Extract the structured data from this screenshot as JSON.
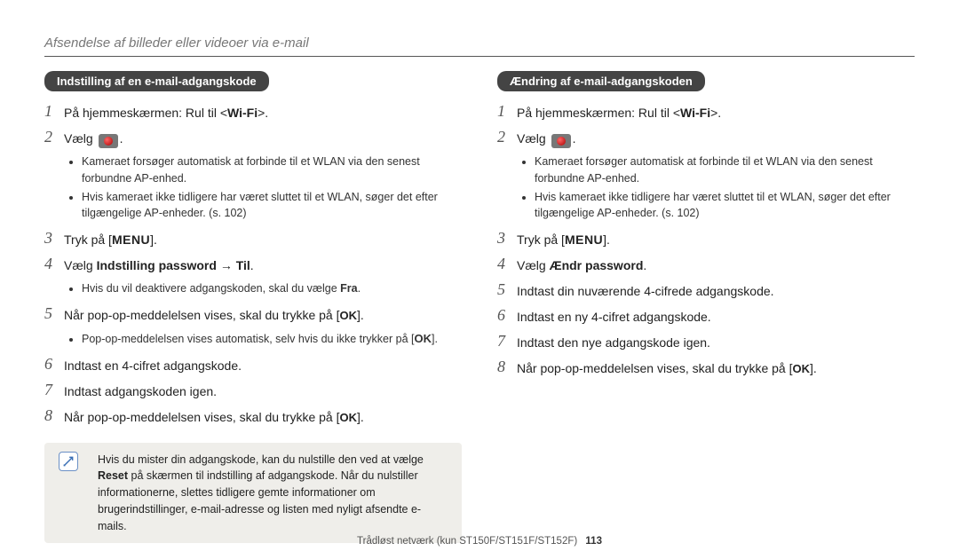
{
  "header": {
    "title": "Afsendelse af billeder eller videoer via e-mail"
  },
  "left": {
    "badge": "Indstilling af en e-mail-adgangskode",
    "step1_pre": "På hjemmeskærmen: Rul til <",
    "step1_bold": "Wi-Fi",
    "step1_post": ">.",
    "step2": "Vælg",
    "bullets_a": "Kameraet forsøger automatisk at forbinde til et WLAN via den senest forbundne AP-enhed.",
    "bullets_b": "Hvis kameraet ikke tidligere har været sluttet til et WLAN, søger det efter tilgængelige AP-enheder. (s. 102)",
    "step3_pre": "Tryk på [",
    "menu": "MENU",
    "step3_post": "].",
    "step4_pre": "Vælg ",
    "step4_bold": "Indstilling password → Til",
    "step4_post": ".",
    "bullets_c": "Hvis du vil deaktivere adgangskoden, skal du vælge ",
    "bullets_c_bold": "Fra",
    "step5_pre": " Når pop-op-meddelelsen vises, skal du trykke på [",
    "ok": "OK",
    "step5_post": "].",
    "bullets_d": "Pop-op-meddelelsen vises automatisk, selv hvis du ikke trykker på [",
    "step6": "Indtast en 4-cifret adgangskode.",
    "step7": "Indtast adgangskoden igen.",
    "step8_pre": "Når pop-op-meddelelsen vises, skal du trykke på [",
    "note_a": "Hvis du mister din adgangskode, kan du nulstille den ved at vælge ",
    "note_bold": "Reset",
    "note_b": " på skærmen til indstilling af adgangskode. Når du nulstiller informationerne, slettes tidligere gemte informationer om brugerindstillinger, e-mail-adresse og listen med nyligt afsendte e-mails."
  },
  "right": {
    "badge": "Ændring af e-mail-adgangskoden",
    "step1_pre": "På hjemmeskærmen: Rul til <",
    "step1_bold": "Wi-Fi",
    "step1_post": ">.",
    "step2": "Vælg",
    "bullets_a": "Kameraet forsøger automatisk at forbinde til et WLAN via den senest forbundne AP-enhed.",
    "bullets_b": "Hvis kameraet ikke tidligere har været sluttet til et WLAN, søger det efter tilgængelige AP-enheder. (s. 102)",
    "step3_pre": "Tryk på [",
    "menu": "MENU",
    "step3_post": "].",
    "step4_pre": "Vælg ",
    "step4_bold": "Ændr password",
    "step4_post": ".",
    "step5": "Indtast din nuværende 4-cifrede adgangskode.",
    "step6": "Indtast en ny 4-cifret adgangskode.",
    "step7": "Indtast den nye adgangskode igen.",
    "step8_pre": "Når pop-op-meddelelsen vises, skal du trykke på [",
    "ok": "OK",
    "step8_post": "]."
  },
  "footer": {
    "text": "Trådløst netværk (kun ST150F/ST151F/ST152F)",
    "page": "113"
  }
}
